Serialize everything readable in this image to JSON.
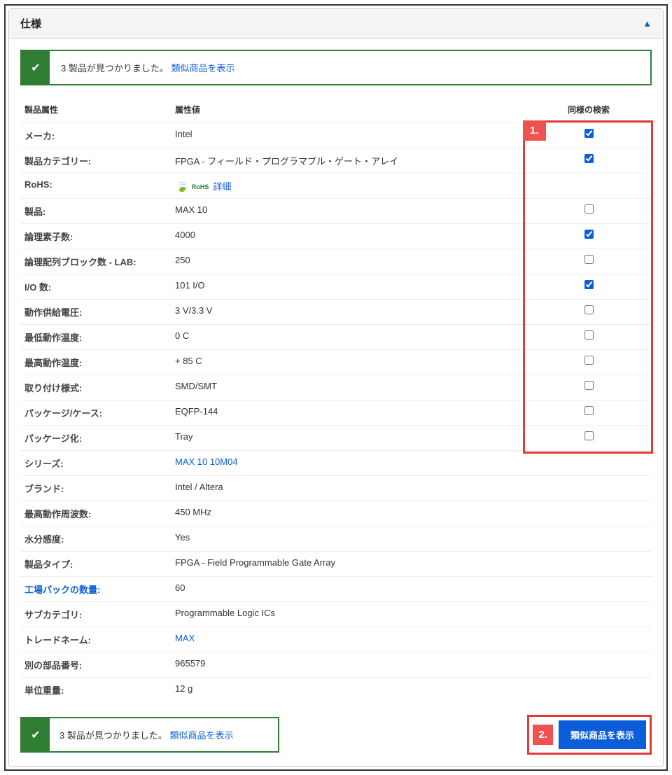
{
  "panel": {
    "title": "仕様"
  },
  "alert_top": {
    "message": "3 製品が見つかりました。 ",
    "link": "類似商品を表示"
  },
  "table": {
    "headers": {
      "attr": "製品属性",
      "val": "属性値",
      "chk": "同様の検索"
    },
    "rows": [
      {
        "attr": "メーカ:",
        "val": "Intel",
        "chk": true,
        "has_chk": true
      },
      {
        "attr": "製品カテゴリー:",
        "val": "FPGA - フィールド・プログラマブル・ゲート・アレイ",
        "chk": true,
        "has_chk": true
      },
      {
        "attr": "RoHS:",
        "val_rohs": true,
        "rohs_link": "詳細",
        "has_chk": false
      },
      {
        "attr": "製品:",
        "val": "MAX 10",
        "chk": false,
        "has_chk": true
      },
      {
        "attr": "論理素子数:",
        "val": "4000",
        "chk": true,
        "has_chk": true
      },
      {
        "attr": "論理配列ブロック数 - LAB:",
        "val": "250",
        "chk": false,
        "has_chk": true
      },
      {
        "attr": "I/O 数:",
        "val": "101 I/O",
        "chk": true,
        "has_chk": true
      },
      {
        "attr": "動作供給電圧:",
        "val": "3 V/3.3 V",
        "chk": false,
        "has_chk": true
      },
      {
        "attr": "最低動作温度:",
        "val": "0 C",
        "chk": false,
        "has_chk": true
      },
      {
        "attr": "最高動作温度:",
        "val": "+ 85 C",
        "chk": false,
        "has_chk": true
      },
      {
        "attr": "取り付け様式:",
        "val": "SMD/SMT",
        "chk": false,
        "has_chk": true
      },
      {
        "attr": "パッケージ/ケース:",
        "val": "EQFP-144",
        "chk": false,
        "has_chk": true
      },
      {
        "attr": "パッケージ化:",
        "val": "Tray",
        "chk": false,
        "has_chk": true
      },
      {
        "attr": "シリーズ:",
        "val": "MAX 10 10M04",
        "link": true,
        "has_chk": false
      },
      {
        "attr": "ブランド:",
        "val": "Intel / Altera",
        "has_chk": false
      },
      {
        "attr": "最高動作周波数:",
        "val": "450 MHz",
        "has_chk": false
      },
      {
        "attr": "水分感度:",
        "val": "Yes",
        "has_chk": false
      },
      {
        "attr": "製品タイプ:",
        "val": "FPGA - Field Programmable Gate Array",
        "has_chk": false
      },
      {
        "attr": "工場パックの数量:",
        "attr_link": true,
        "val": "60",
        "has_chk": false
      },
      {
        "attr": "サブカテゴリ:",
        "val": "Programmable Logic ICs",
        "has_chk": false
      },
      {
        "attr": "トレードネーム:",
        "val": "MAX",
        "link": true,
        "has_chk": false
      },
      {
        "attr": "別の部品番号:",
        "val": "965579",
        "has_chk": false
      },
      {
        "attr": "単位重量:",
        "val": "12 g",
        "has_chk": false
      }
    ]
  },
  "alert_bottom": {
    "message": "3 製品が見つかりました。 ",
    "link": "類似商品を表示"
  },
  "button": {
    "label": "類似商品を表示"
  },
  "annotations": {
    "tag1": "1.",
    "tag2": "2."
  }
}
